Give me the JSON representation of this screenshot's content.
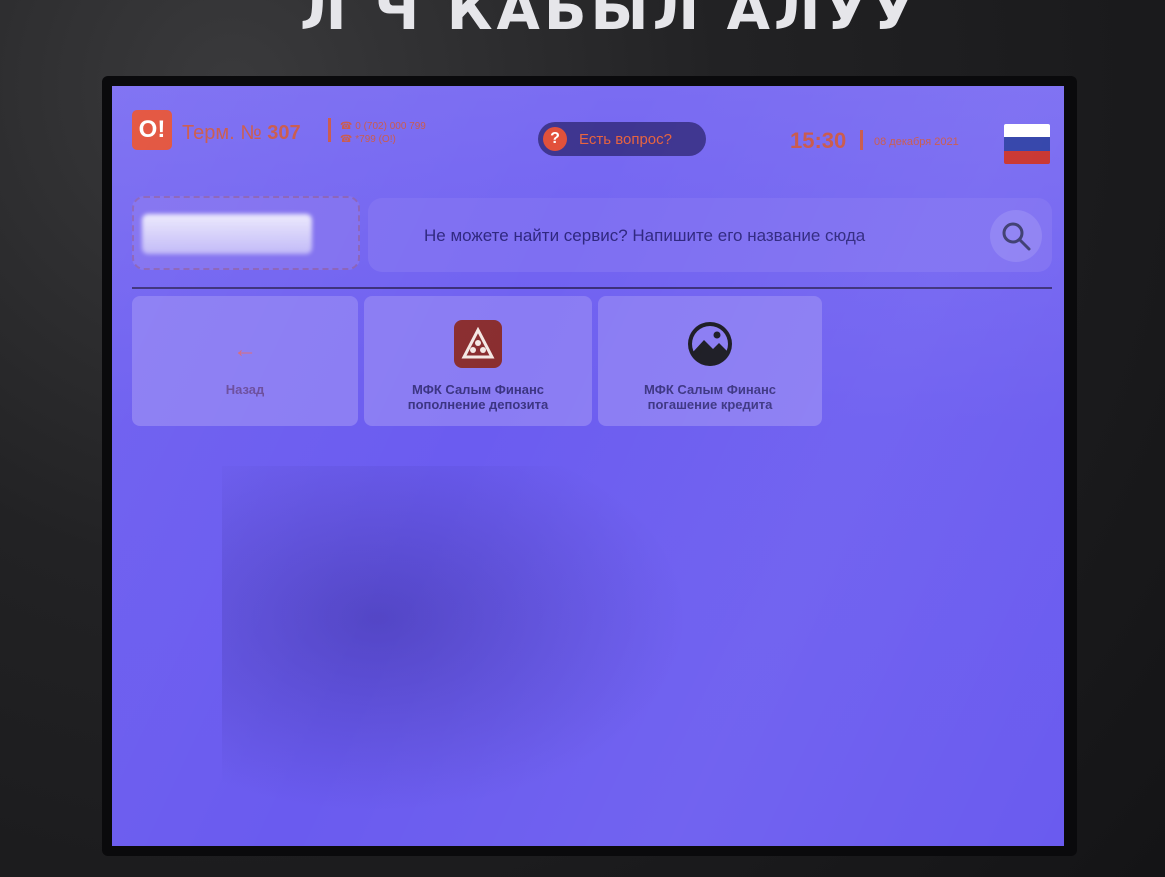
{
  "kiosk": {
    "sign_text": "Л Ч КАБЫЛ АЛУУ"
  },
  "header": {
    "logo_text": "O!",
    "terminal_prefix": "Терм. №",
    "terminal_number": "307",
    "phone_primary": "0 (702) 000 799",
    "phone_short": "*799 (О!)",
    "help_label": "Есть вопрос?",
    "help_icon": "?",
    "time": "15:30",
    "date": "08 декабря 2021",
    "flag_colors": [
      "#ffffff",
      "#2e3fa8",
      "#c8302b"
    ]
  },
  "search": {
    "placeholder": "Не можете найти сервис? Напишите его название сюда",
    "icon": "search-icon"
  },
  "tiles": [
    {
      "label": "Назад",
      "icon": "arrow-left-icon"
    },
    {
      "label_line1": "МФК Салым Финанс",
      "label_line2": "пополнение депозита",
      "icon": "salym-logo-icon"
    },
    {
      "label_line1": "МФК Салым Финанс",
      "label_line2": "погашение кредита",
      "icon": "image-placeholder-icon"
    }
  ],
  "colors": {
    "screen": "#6b5cf0",
    "accent": "#e2503a",
    "help_button": "#3e3590"
  }
}
